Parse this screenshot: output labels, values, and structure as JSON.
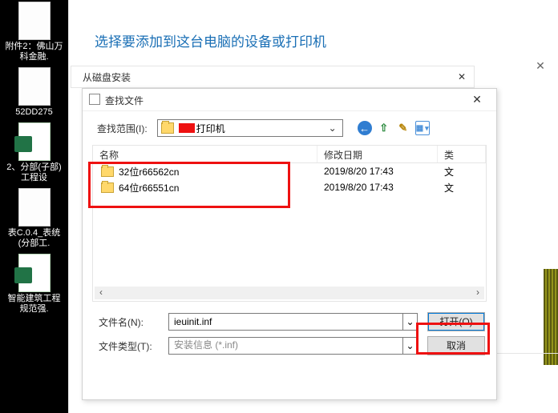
{
  "desktop": {
    "items": [
      {
        "label": "附件2：佛山万科金融."
      },
      {
        "label": "52DD275"
      },
      {
        "label": "2、分部(子部)工程设",
        "xls": true
      },
      {
        "label": "表C.0.4_表统(分部工."
      },
      {
        "label": "智能建筑工程规范强.",
        "xls": true
      }
    ]
  },
  "wizard": {
    "title": "选择要添加到这台电脑的设备或打印机"
  },
  "dlg_disk": {
    "title": "从磁盘安装"
  },
  "dlg_find": {
    "title": "查找文件",
    "range_label": "查找范围(I):",
    "range_value": "打印机",
    "columns": {
      "name": "名称",
      "mtime": "修改日期",
      "type": "类"
    },
    "rows": [
      {
        "name": "32位r66562cn",
        "mtime": "2019/8/20 17:43",
        "type": "文"
      },
      {
        "name": "64位r66551cn",
        "mtime": "2019/8/20 17:43",
        "type": "文"
      }
    ],
    "filename_label": "文件名(N):",
    "filename_value": "ieuinit.inf",
    "filetype_label": "文件类型(T):",
    "filetype_value": "安装信息 (*.inf)",
    "open_btn": "打开(O)",
    "cancel_btn": "取消"
  }
}
